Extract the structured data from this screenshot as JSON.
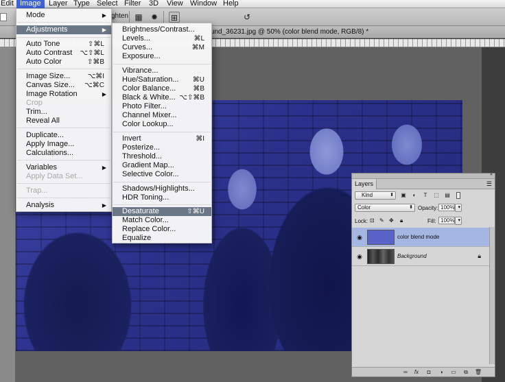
{
  "menubar": {
    "items": [
      {
        "label": "Edit"
      },
      {
        "label": "Image"
      },
      {
        "label": "Layer"
      },
      {
        "label": "Type"
      },
      {
        "label": "Select"
      },
      {
        "label": "Filter"
      },
      {
        "label": "3D"
      },
      {
        "label": "View"
      },
      {
        "label": "Window"
      },
      {
        "label": "Help"
      }
    ]
  },
  "optionsbar": {
    "partial_label": "ghten",
    "icons": [
      "grid-icon",
      "gear-icon",
      "align-icon",
      "rotate-back-icon"
    ]
  },
  "document": {
    "title": "round_36231.jpg @ 50% (color blend mode, RGB/8) *"
  },
  "image_menu": {
    "items": [
      {
        "label": "Mode",
        "submenu": true
      },
      {
        "label": "Adjustments",
        "submenu": true,
        "highlighted": true
      },
      {
        "label": "Auto Tone",
        "shortcut": "⇧⌘L"
      },
      {
        "label": "Auto Contrast",
        "shortcut": "⌥⇧⌘L"
      },
      {
        "label": "Auto Color",
        "shortcut": "⇧⌘B"
      },
      {
        "label": "Image Size...",
        "shortcut": "⌥⌘I"
      },
      {
        "label": "Canvas Size...",
        "shortcut": "⌥⌘C"
      },
      {
        "label": "Image Rotation",
        "submenu": true
      },
      {
        "label": "Crop",
        "disabled": true
      },
      {
        "label": "Trim..."
      },
      {
        "label": "Reveal All"
      },
      {
        "label": "Duplicate..."
      },
      {
        "label": "Apply Image..."
      },
      {
        "label": "Calculations..."
      },
      {
        "label": "Variables",
        "submenu": true
      },
      {
        "label": "Apply Data Set...",
        "disabled": true
      },
      {
        "label": "Trap...",
        "disabled": true
      },
      {
        "label": "Analysis",
        "submenu": true
      }
    ]
  },
  "adjustments_menu": {
    "items": [
      {
        "label": "Brightness/Contrast..."
      },
      {
        "label": "Levels...",
        "shortcut": "⌘L"
      },
      {
        "label": "Curves...",
        "shortcut": "⌘M"
      },
      {
        "label": "Exposure..."
      },
      {
        "label": "Vibrance..."
      },
      {
        "label": "Hue/Saturation...",
        "shortcut": "⌘U"
      },
      {
        "label": "Color Balance...",
        "shortcut": "⌘B"
      },
      {
        "label": "Black & White...",
        "shortcut": "⌥⇧⌘B"
      },
      {
        "label": "Photo Filter..."
      },
      {
        "label": "Channel Mixer..."
      },
      {
        "label": "Color Lookup..."
      },
      {
        "label": "Invert",
        "shortcut": "⌘I"
      },
      {
        "label": "Posterize..."
      },
      {
        "label": "Threshold..."
      },
      {
        "label": "Gradient Map..."
      },
      {
        "label": "Selective Color..."
      },
      {
        "label": "Shadows/Highlights..."
      },
      {
        "label": "HDR Toning..."
      },
      {
        "label": "Desaturate",
        "shortcut": "⇧⌘U",
        "highlighted": true
      },
      {
        "label": "Match Color..."
      },
      {
        "label": "Replace Color..."
      },
      {
        "label": "Equalize"
      }
    ]
  },
  "layers_panel": {
    "tab": "Layers",
    "kind_filter": "Kind",
    "blend_mode": "Color",
    "opacity_label": "Opacity:",
    "opacity": "100%",
    "lock_label": "Lock:",
    "fill_label": "Fill:",
    "fill": "100%",
    "layers": [
      {
        "name": "color blend mode",
        "selected": true,
        "thumb_color": "#5a63c8"
      },
      {
        "name": "Background",
        "selected": false,
        "locked": true
      }
    ]
  },
  "colors": {
    "menu_highlight": "#6c7786",
    "active_menubar": "#3f63d9",
    "selected_layer": "#a5b6e3",
    "photo_tint": "#2a3089"
  }
}
